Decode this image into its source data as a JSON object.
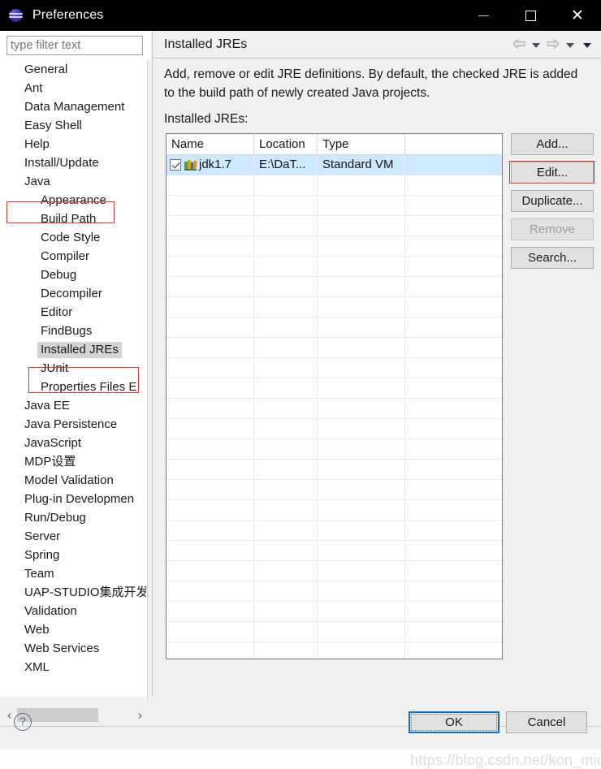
{
  "window": {
    "title": "Preferences",
    "icon": "eclipse-logo-icon",
    "minimize_label": "",
    "maximize_label": "",
    "close_label": "✕"
  },
  "sidebar": {
    "filter": {
      "value": "",
      "placeholder": "type filter text"
    },
    "scroll": {
      "left_arrow": "‹",
      "right_arrow": "›"
    },
    "items": [
      {
        "label": "General",
        "level": 1,
        "selected": false
      },
      {
        "label": "Ant",
        "level": 1,
        "selected": false
      },
      {
        "label": "Data Management",
        "level": 1,
        "selected": false
      },
      {
        "label": "Easy Shell",
        "level": 1,
        "selected": false
      },
      {
        "label": "Help",
        "level": 1,
        "selected": false
      },
      {
        "label": "Install/Update",
        "level": 1,
        "selected": false
      },
      {
        "label": "Java",
        "level": 1,
        "selected": false
      },
      {
        "label": "Appearance",
        "level": 2,
        "selected": false
      },
      {
        "label": "Build Path",
        "level": 2,
        "selected": false
      },
      {
        "label": "Code Style",
        "level": 2,
        "selected": false
      },
      {
        "label": "Compiler",
        "level": 2,
        "selected": false
      },
      {
        "label": "Debug",
        "level": 2,
        "selected": false
      },
      {
        "label": "Decompiler",
        "level": 2,
        "selected": false
      },
      {
        "label": "Editor",
        "level": 2,
        "selected": false
      },
      {
        "label": "FindBugs",
        "level": 2,
        "selected": false
      },
      {
        "label": "Installed JREs",
        "level": 2,
        "selected": true
      },
      {
        "label": "JUnit",
        "level": 2,
        "selected": false
      },
      {
        "label": "Properties Files E",
        "level": 2,
        "selected": false
      },
      {
        "label": "Java EE",
        "level": 1,
        "selected": false
      },
      {
        "label": "Java Persistence",
        "level": 1,
        "selected": false
      },
      {
        "label": "JavaScript",
        "level": 1,
        "selected": false
      },
      {
        "label": "MDP设置",
        "level": 1,
        "selected": false
      },
      {
        "label": "Model Validation",
        "level": 1,
        "selected": false
      },
      {
        "label": "Plug-in Developmen",
        "level": 1,
        "selected": false
      },
      {
        "label": "Run/Debug",
        "level": 1,
        "selected": false
      },
      {
        "label": "Server",
        "level": 1,
        "selected": false
      },
      {
        "label": "Spring",
        "level": 1,
        "selected": false
      },
      {
        "label": "Team",
        "level": 1,
        "selected": false
      },
      {
        "label": "UAP-STUDIO集成开发",
        "level": 1,
        "selected": false
      },
      {
        "label": "Validation",
        "level": 1,
        "selected": false
      },
      {
        "label": "Web",
        "level": 1,
        "selected": false
      },
      {
        "label": "Web Services",
        "level": 1,
        "selected": false
      },
      {
        "label": "XML",
        "level": 1,
        "selected": false
      }
    ]
  },
  "panel": {
    "title": "Installed JREs",
    "description": "Add, remove or edit JRE definitions. By default, the checked JRE is added to the build path of newly created Java projects.",
    "list_label": "Installed JREs:",
    "nav": {
      "back_icon": "arrow-left-icon",
      "back_menu_icon": "chevron-down-icon",
      "forward_icon": "arrow-right-icon",
      "forward_menu_icon": "chevron-down-icon",
      "more_menu_icon": "chevron-down-icon"
    }
  },
  "table": {
    "columns": [
      "Name",
      "Location",
      "Type",
      ""
    ],
    "rows": [
      {
        "checked": true,
        "icon": "jre-books-icon",
        "name": "jdk1.7",
        "location": "E:\\DaT...",
        "type": "Standard VM",
        "extra": "",
        "selected": true
      }
    ],
    "empty_row_count": 24
  },
  "side_buttons": [
    {
      "label": "Add...",
      "enabled": true,
      "annotated": false
    },
    {
      "label": "Edit...",
      "enabled": true,
      "annotated": true
    },
    {
      "label": "Duplicate...",
      "enabled": true,
      "annotated": false
    },
    {
      "label": "Remove",
      "enabled": false,
      "annotated": false
    },
    {
      "label": "Search...",
      "enabled": true,
      "annotated": false
    }
  ],
  "footer": {
    "help_icon": "question-mark-icon",
    "help_glyph": "?",
    "ok_label": "OK",
    "cancel_label": "Cancel"
  },
  "watermark": {
    "text": "https://blog.csdn.net/kon_mio"
  },
  "colors": {
    "annotation_red": "#e8332a",
    "selection_blue": "#cde8ff",
    "focus_blue": "#0a73c6",
    "titlebar_black": "#000000",
    "dialog_gray": "#f0f0f0"
  }
}
